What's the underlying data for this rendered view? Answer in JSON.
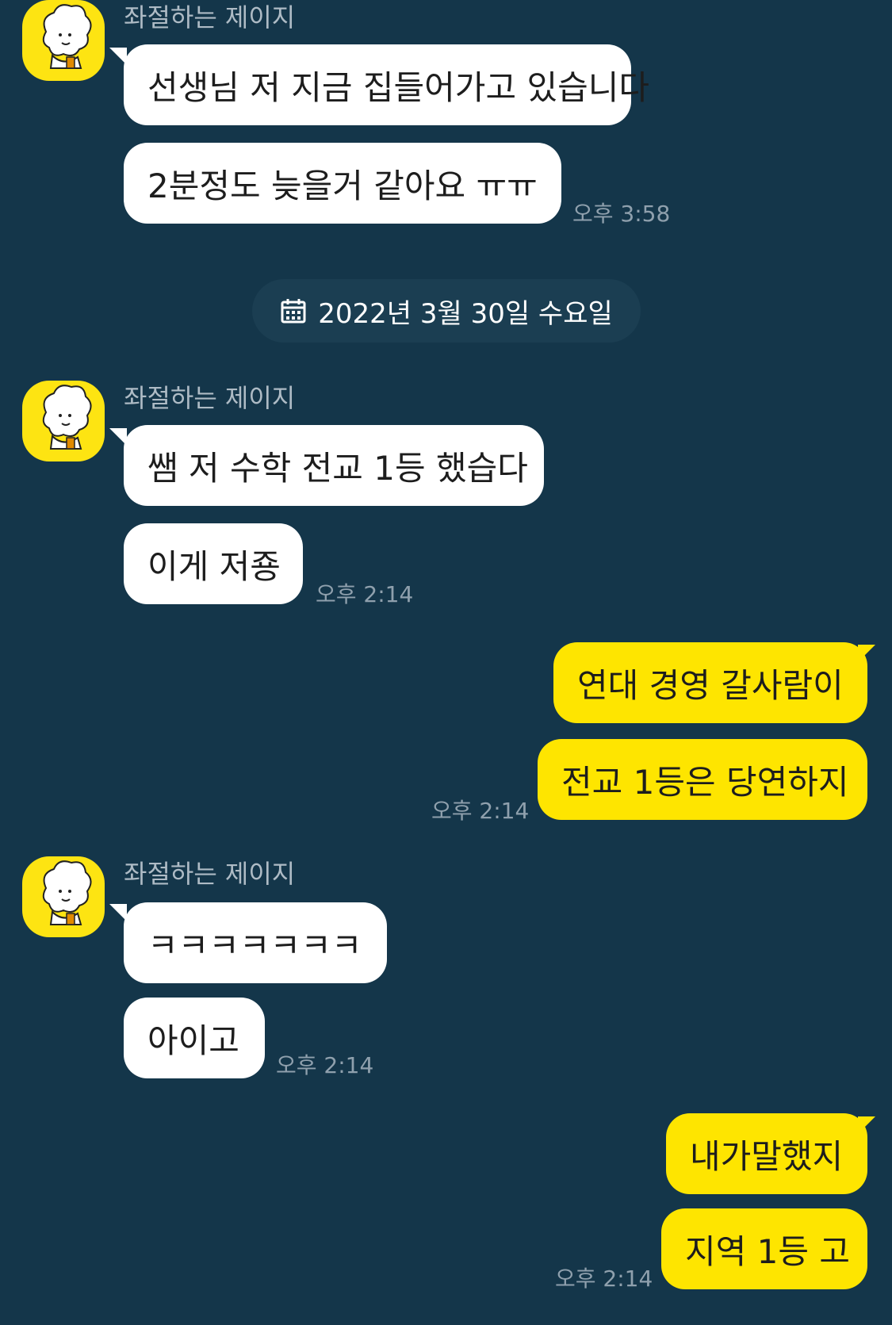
{
  "colors": {
    "background": "#14364a",
    "incoming_bubble": "#ffffff",
    "outgoing_bubble": "#fee500",
    "avatar_bg": "#fde412",
    "date_pill": "#1b3e52"
  },
  "contact": {
    "name": "좌절하는 제이지",
    "avatar_icon": "cartoon-character-avatar"
  },
  "date_divider": {
    "icon": "calendar-icon",
    "text": "2022년 3월 30일 수요일"
  },
  "groups": [
    {
      "direction": "incoming",
      "sender": "좌절하는 제이지",
      "messages": [
        "선생님 저 지금 집들어가고 있습니다",
        "2분정도 늦을거 같아요 ㅠㅠ"
      ],
      "time": "오후 3:58"
    },
    {
      "direction": "incoming",
      "sender": "좌절하는 제이지",
      "messages": [
        "쌤 저 수학 전교 1등 했습다",
        "이게 저죵"
      ],
      "time": "오후 2:14"
    },
    {
      "direction": "outgoing",
      "messages": [
        "연대 경영 갈사람이",
        "전교 1등은 당연하지"
      ],
      "time": "오후 2:14"
    },
    {
      "direction": "incoming",
      "sender": "좌절하는 제이지",
      "messages": [
        "ㅋㅋㅋㅋㅋㅋㅋ",
        "아이고"
      ],
      "time": "오후 2:14"
    },
    {
      "direction": "outgoing",
      "messages": [
        "내가말했지",
        "지역 1등 고"
      ],
      "time": "오후 2:14"
    }
  ]
}
